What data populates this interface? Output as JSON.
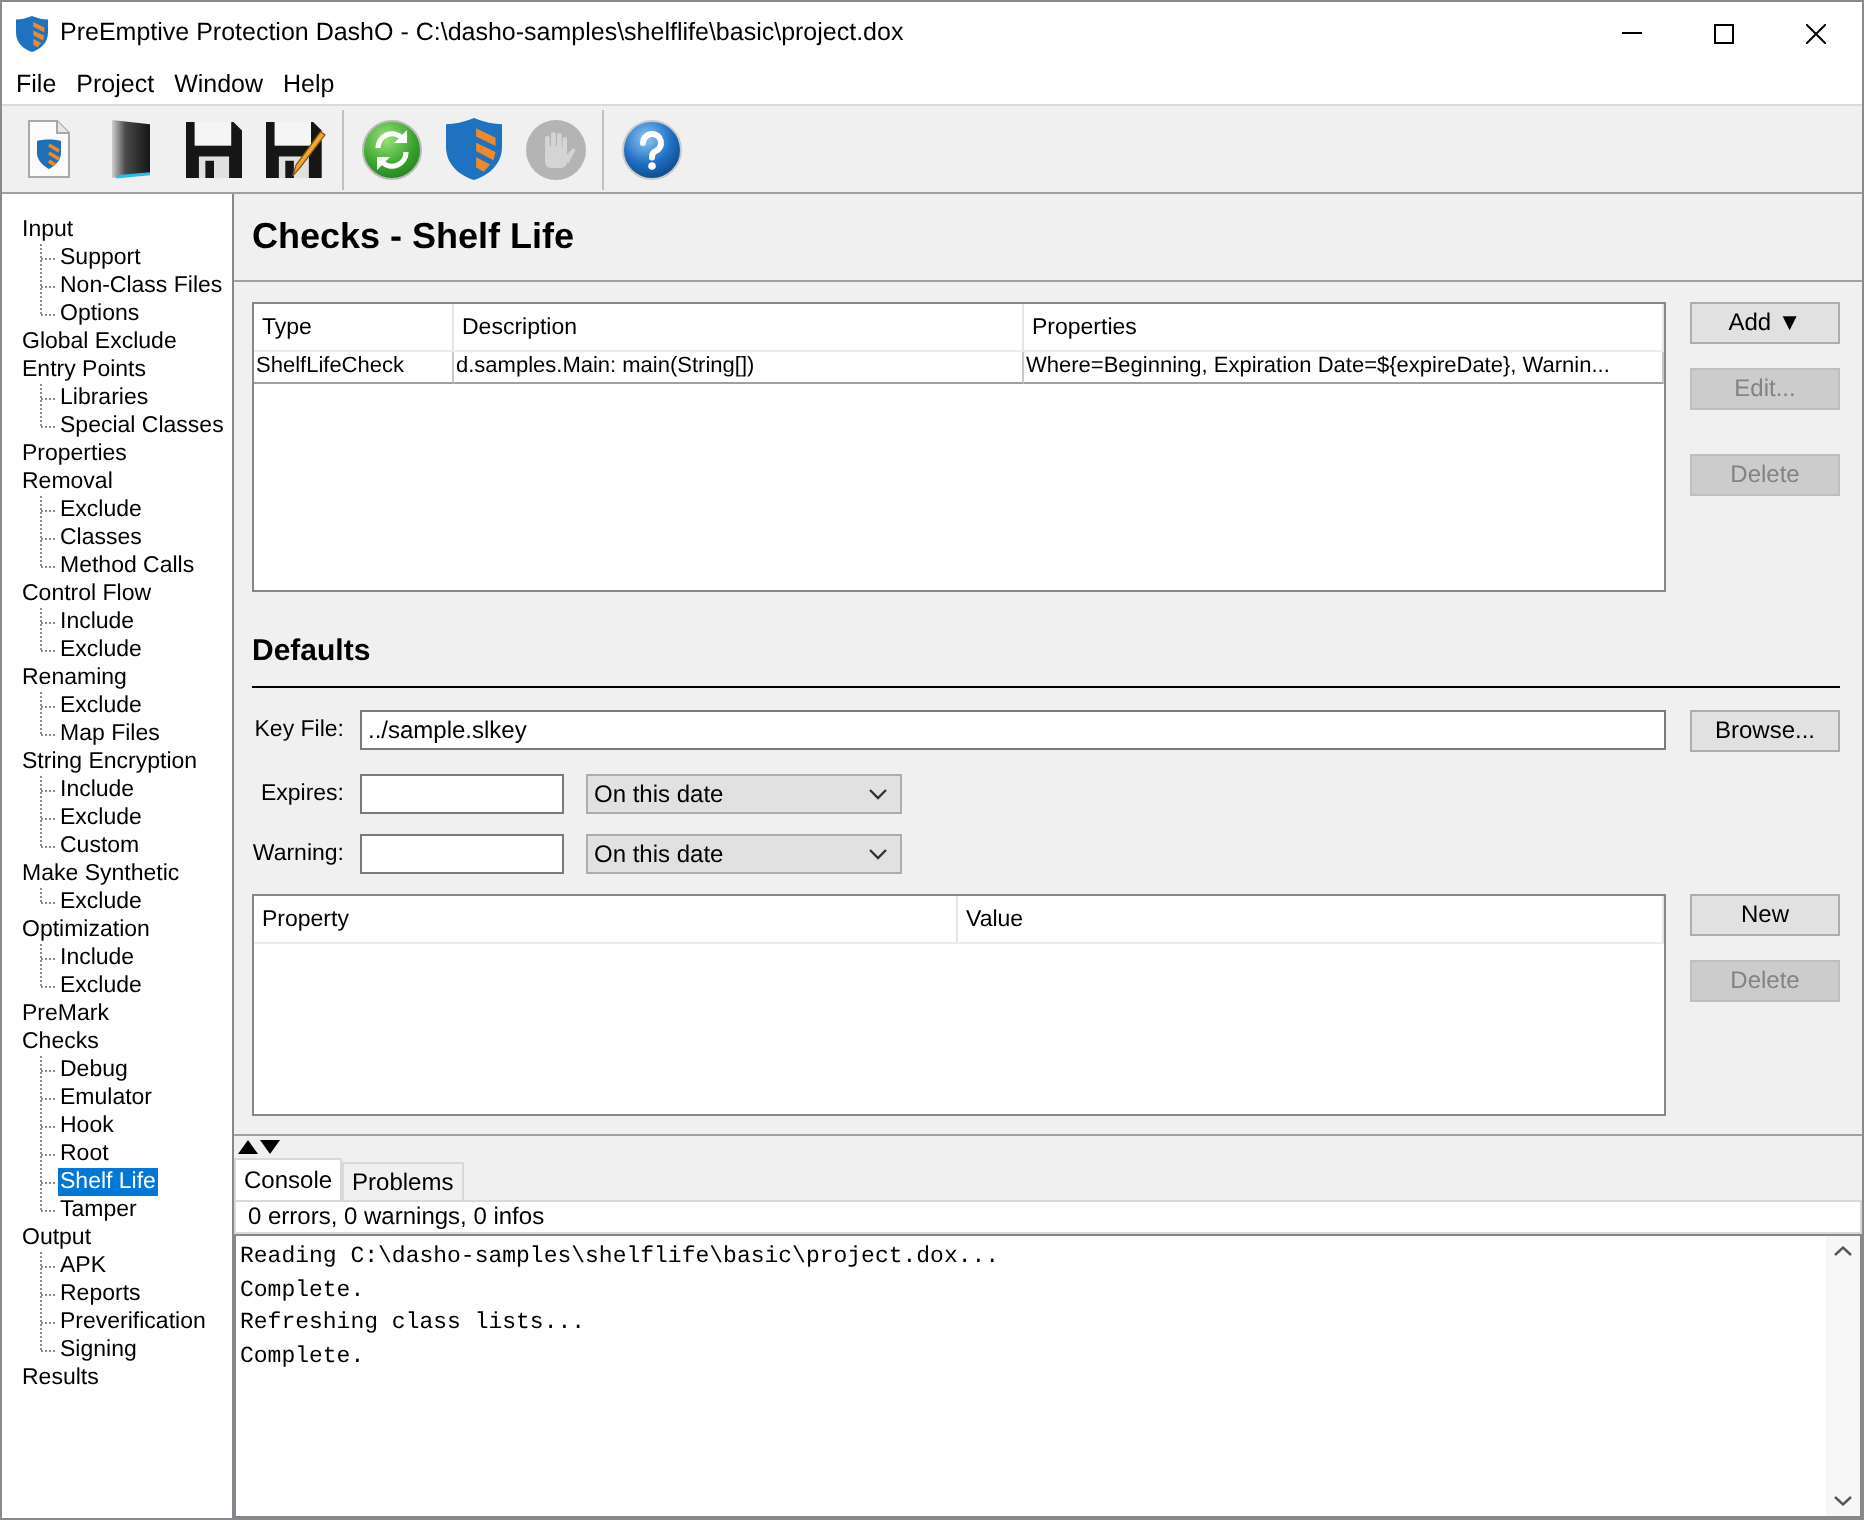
{
  "window": {
    "title": "PreEmptive Protection DashO - C:\\dasho-samples\\shelflife\\basic\\project.dox"
  },
  "menu": [
    {
      "label": "File"
    },
    {
      "label": "Project"
    },
    {
      "label": "Window"
    },
    {
      "label": "Help"
    }
  ],
  "toolbar": {
    "groups": [
      {
        "buttons": [
          {
            "kind": "document",
            "disabled": false
          },
          {
            "kind": "folder",
            "disabled": false
          },
          {
            "kind": "save",
            "disabled": false
          },
          {
            "kind": "save-as",
            "disabled": false
          }
        ]
      },
      {
        "buttons": [
          {
            "kind": "refresh",
            "disabled": false
          },
          {
            "kind": "shield",
            "disabled": false
          },
          {
            "kind": "hand",
            "disabled": true
          }
        ]
      },
      {
        "buttons": [
          {
            "kind": "help",
            "disabled": false
          }
        ]
      }
    ]
  },
  "sidebar": {
    "items": [
      {
        "label": "Input",
        "selected": false,
        "children": [
          {
            "label": "Support",
            "selected": false
          },
          {
            "label": "Non-Class Files",
            "selected": false
          },
          {
            "label": "Options",
            "selected": false
          }
        ]
      },
      {
        "label": "Global Exclude",
        "selected": false
      },
      {
        "label": "Entry Points",
        "selected": false,
        "children": [
          {
            "label": "Libraries",
            "selected": false
          },
          {
            "label": "Special Classes",
            "selected": false
          }
        ]
      },
      {
        "label": "Properties",
        "selected": false
      },
      {
        "label": "Removal",
        "selected": false,
        "children": [
          {
            "label": "Exclude",
            "selected": false
          },
          {
            "label": "Classes",
            "selected": false
          },
          {
            "label": "Method Calls",
            "selected": false
          }
        ]
      },
      {
        "label": "Control Flow",
        "selected": false,
        "children": [
          {
            "label": "Include",
            "selected": false
          },
          {
            "label": "Exclude",
            "selected": false
          }
        ]
      },
      {
        "label": "Renaming",
        "selected": false,
        "children": [
          {
            "label": "Exclude",
            "selected": false
          },
          {
            "label": "Map Files",
            "selected": false
          }
        ]
      },
      {
        "label": "String Encryption",
        "selected": false,
        "children": [
          {
            "label": "Include",
            "selected": false
          },
          {
            "label": "Exclude",
            "selected": false
          },
          {
            "label": "Custom",
            "selected": false
          }
        ]
      },
      {
        "label": "Make Synthetic",
        "selected": false,
        "children": [
          {
            "label": "Exclude",
            "selected": false
          }
        ]
      },
      {
        "label": "Optimization",
        "selected": false,
        "children": [
          {
            "label": "Include",
            "selected": false
          },
          {
            "label": "Exclude",
            "selected": false
          }
        ]
      },
      {
        "label": "PreMark",
        "selected": false
      },
      {
        "label": "Checks",
        "selected": false,
        "children": [
          {
            "label": "Debug",
            "selected": false
          },
          {
            "label": "Emulator",
            "selected": false
          },
          {
            "label": "Hook",
            "selected": false
          },
          {
            "label": "Root",
            "selected": false
          },
          {
            "label": "Shelf Life",
            "selected": true
          },
          {
            "label": "Tamper",
            "selected": false
          }
        ]
      },
      {
        "label": "Output",
        "selected": false,
        "children": [
          {
            "label": "APK",
            "selected": false
          },
          {
            "label": "Reports",
            "selected": false
          },
          {
            "label": "Preverification",
            "selected": false
          },
          {
            "label": "Signing",
            "selected": false
          }
        ]
      },
      {
        "label": "Results",
        "selected": false
      }
    ]
  },
  "page": {
    "title": "Checks - Shelf Life"
  },
  "checks_table": {
    "columns": [
      {
        "label": "Type"
      },
      {
        "label": "Description"
      },
      {
        "label": "Properties"
      }
    ],
    "rows": [
      {
        "selected": false,
        "cells": [
          "ShelfLifeCheck",
          "d.samples.Main: main(String[])",
          "Where=Beginning, Expiration Date=${expireDate}, Warnin..."
        ]
      }
    ],
    "buttons": [
      {
        "label": "Add ▼",
        "disabled": false
      },
      {
        "label": "Edit...",
        "disabled": true
      },
      {
        "label": "Delete",
        "disabled": true
      }
    ]
  },
  "defaults": {
    "title": "Defaults",
    "key_file": {
      "label": "Key File:",
      "value": "../sample.slkey"
    },
    "browse_button": {
      "label": "Browse...",
      "disabled": false
    },
    "expires": {
      "label": "Expires:",
      "mode": "On this date"
    },
    "warning": {
      "label": "Warning:",
      "mode": "On this date"
    },
    "properties_table": {
      "columns": [
        {
          "label": "Property"
        },
        {
          "label": "Value"
        }
      ],
      "buttons": [
        {
          "label": "New",
          "disabled": false
        },
        {
          "label": "Delete",
          "disabled": true
        }
      ]
    }
  },
  "bottom_panel": {
    "tabs": [
      {
        "label": "Console",
        "selected": true
      },
      {
        "label": "Problems",
        "selected": false
      }
    ],
    "status": "0 errors, 0 warnings, 0 infos",
    "console_lines": [
      "Reading C:\\dasho-samples\\shelflife\\basic\\project.dox...",
      "Complete.",
      "Refreshing class lists...",
      "Complete."
    ]
  }
}
